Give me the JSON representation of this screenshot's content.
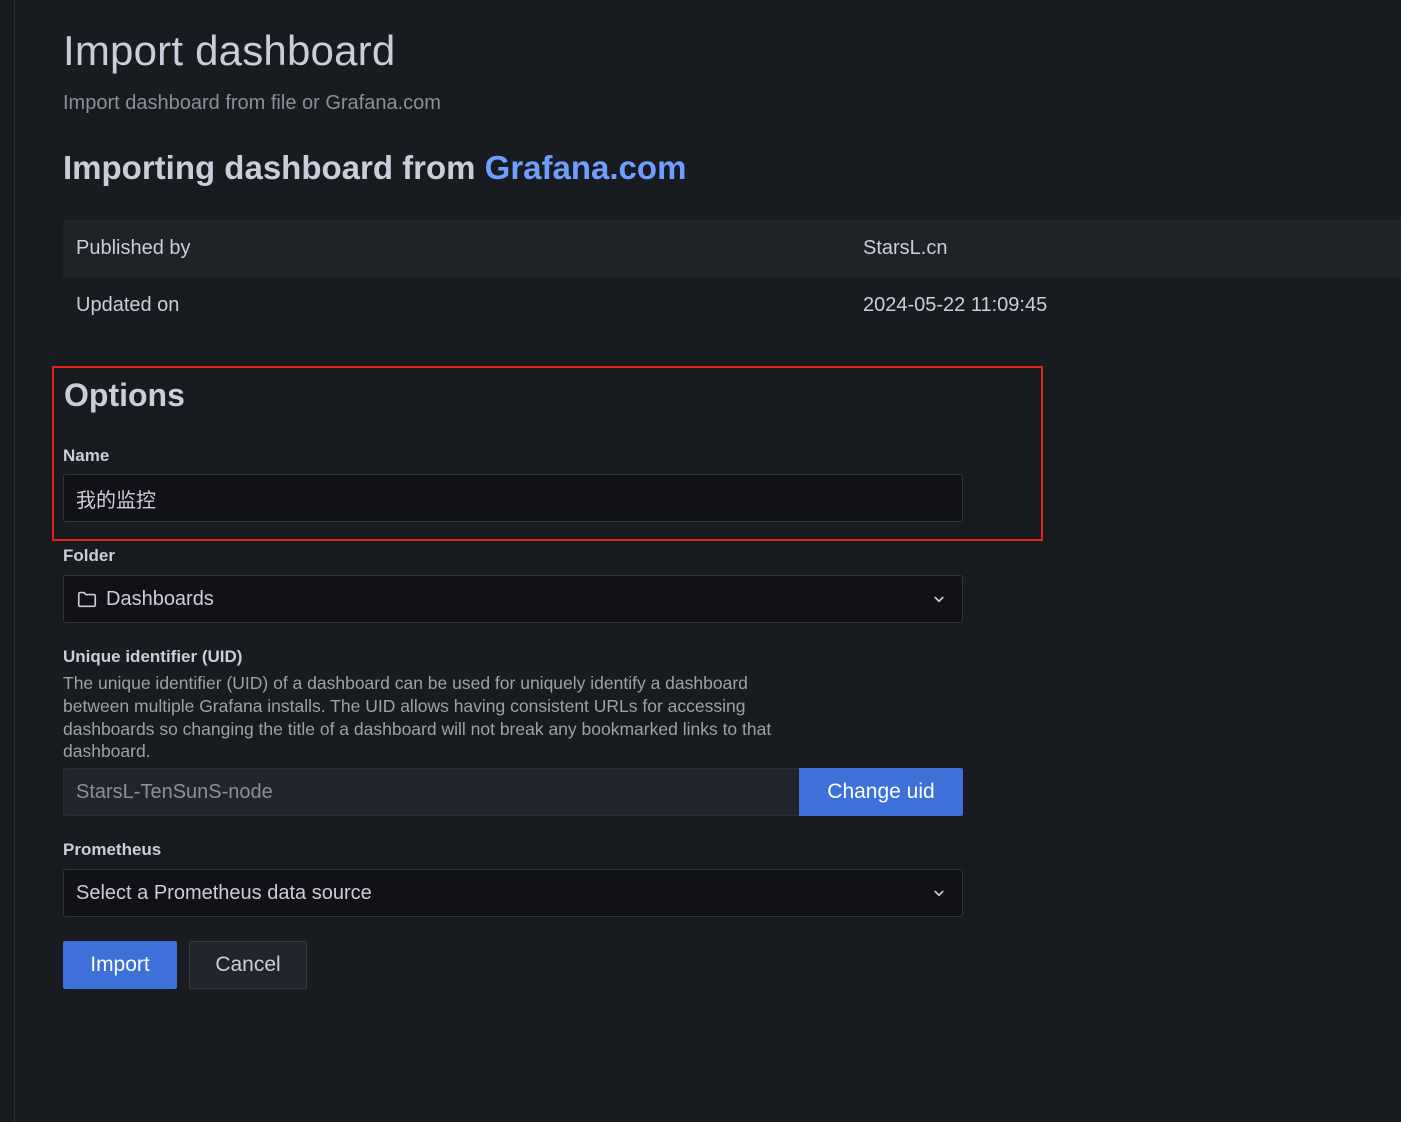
{
  "header": {
    "title": "Import dashboard",
    "subtitle": "Import dashboard from file or Grafana.com"
  },
  "import_source": {
    "prefix": "Importing dashboard from ",
    "link": "Grafana.com"
  },
  "info": [
    {
      "key": "Published by",
      "value": "StarsL.cn"
    },
    {
      "key": "Updated on",
      "value": "2024-05-22 11:09:45"
    }
  ],
  "options": {
    "title": "Options",
    "name": {
      "label": "Name",
      "value": "我的监控"
    },
    "folder": {
      "label": "Folder",
      "value": "Dashboards"
    },
    "uid": {
      "label": "Unique identifier (UID)",
      "description": "The unique identifier (UID) of a dashboard can be used for uniquely identify a dashboard between multiple Grafana installs. The UID allows having consistent URLs for accessing dashboards so changing the title of a dashboard will not break any bookmarked links to that dashboard.",
      "value": "StarsL-TenSunS-node",
      "change_label": "Change uid"
    },
    "prometheus": {
      "label": "Prometheus",
      "placeholder": "Select a Prometheus data source"
    }
  },
  "actions": {
    "import_label": "Import",
    "cancel_label": "Cancel"
  },
  "colors": {
    "accent": "#3d71d9",
    "link": "#6e9fff",
    "highlight": "#e3241c"
  }
}
